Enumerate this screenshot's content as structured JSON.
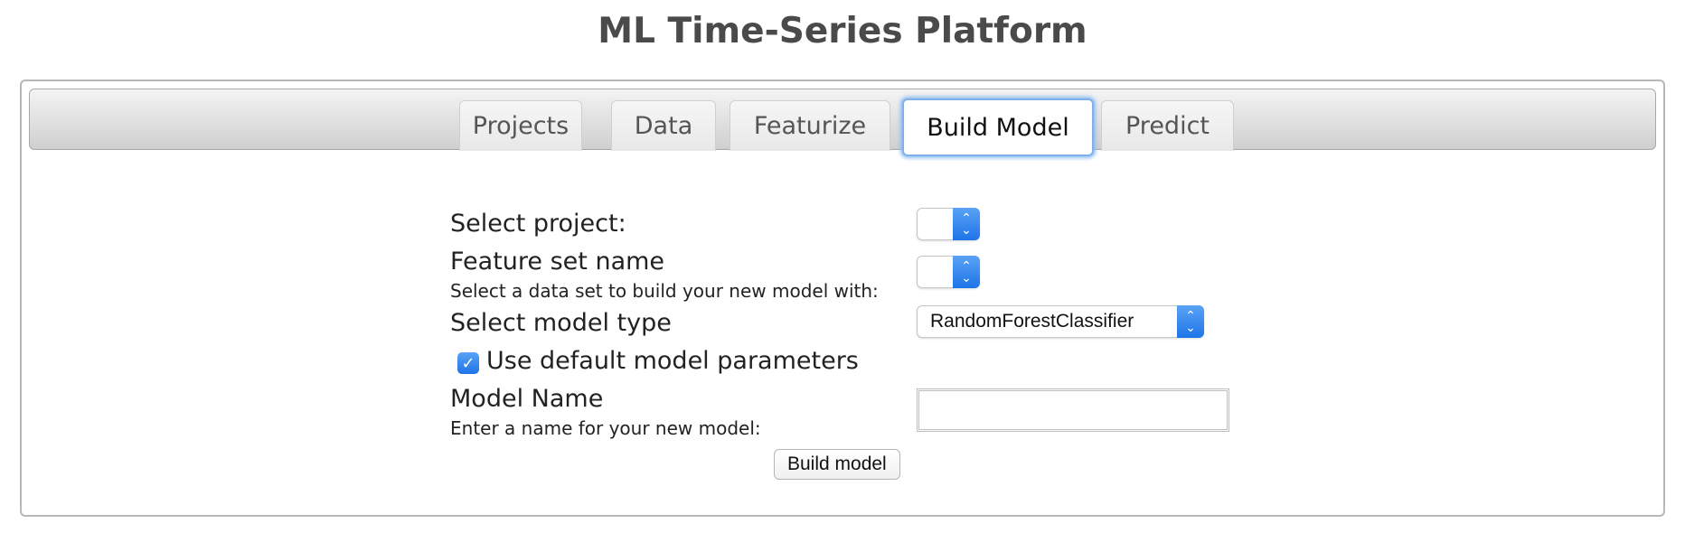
{
  "header": {
    "title": "ML Time-Series Platform"
  },
  "tabs": [
    {
      "label": "Projects",
      "active": false
    },
    {
      "label": "Data",
      "active": false
    },
    {
      "label": "Featurize",
      "active": false
    },
    {
      "label": "Build Model",
      "active": true
    },
    {
      "label": "Predict",
      "active": false
    }
  ],
  "form": {
    "project": {
      "label": "Select project:",
      "value": ""
    },
    "feature_set": {
      "label": "Feature set name",
      "sublabel": "Select a data set to build your new model with:",
      "value": ""
    },
    "model_type": {
      "label": "Select model type",
      "value": "RandomForestClassifier"
    },
    "default_params": {
      "label": "Use default model parameters",
      "checked": true
    },
    "model_name": {
      "label": "Model Name",
      "sublabel": "Enter a name for your new model:",
      "value": "",
      "placeholder": ""
    },
    "submit_label": "Build model"
  },
  "colors": {
    "accent": "#1e74e8",
    "active_tab_glow": "#8ebdf2",
    "title": "#4a4a4a"
  }
}
